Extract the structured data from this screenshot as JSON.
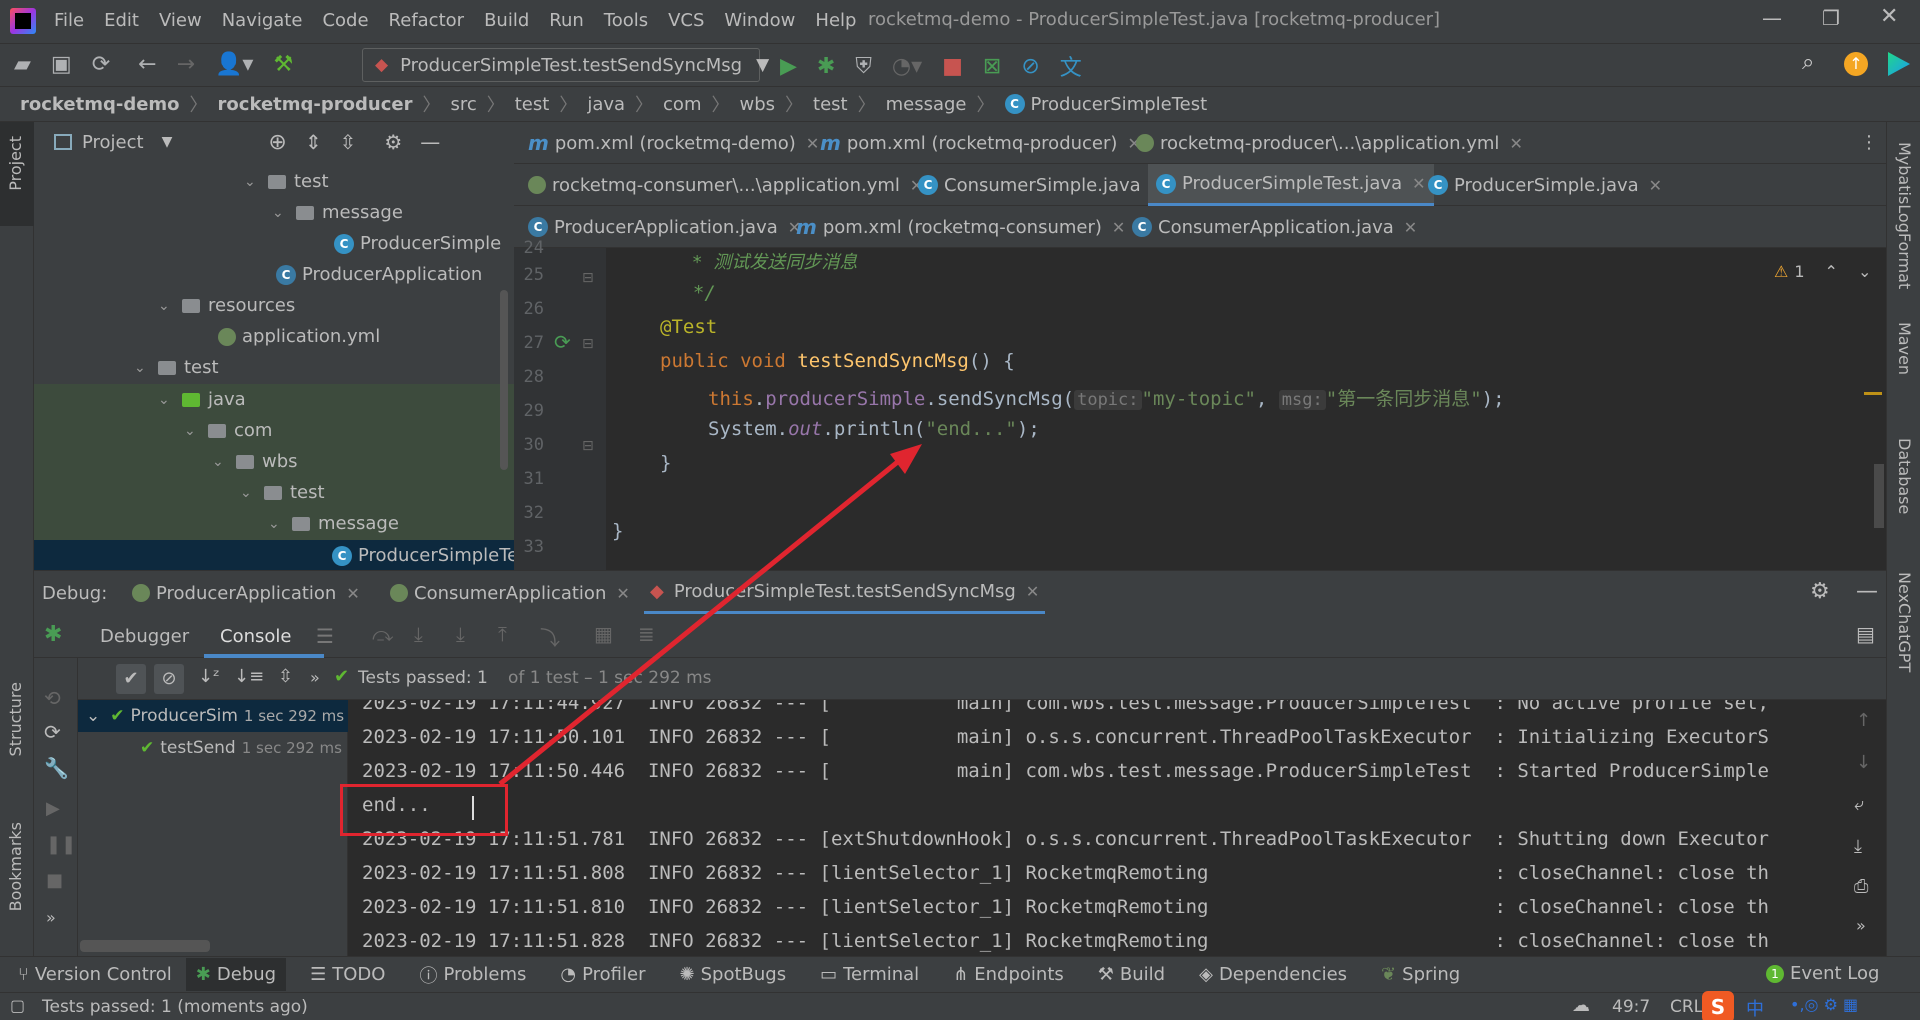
{
  "window": {
    "title": "rocketmq-demo - ProducerSimpleTest.java [rocketmq-producer]",
    "menu": [
      "File",
      "Edit",
      "View",
      "Navigate",
      "Code",
      "Refactor",
      "Build",
      "Run",
      "Tools",
      "VCS",
      "Window",
      "Help"
    ]
  },
  "toolbar": {
    "run_config": "ProducerSimpleTest.testSendSyncMsg"
  },
  "breadcrumb": [
    "rocketmq-demo",
    "rocketmq-producer",
    "src",
    "test",
    "java",
    "com",
    "wbs",
    "test",
    "message",
    "ProducerSimpleTest"
  ],
  "project": {
    "title": "Project",
    "side_label": "Project",
    "tree": [
      {
        "label": "test",
        "indent": 1
      },
      {
        "label": "message",
        "indent": 2
      },
      {
        "label": "ProducerSimple",
        "indent": 3
      },
      {
        "label": "ProducerApplication",
        "indent": 2
      },
      {
        "label": "resources",
        "indent": 1
      },
      {
        "label": "application.yml",
        "indent": 2
      },
      {
        "label": "test",
        "indent": 0
      },
      {
        "label": "java",
        "indent": 1
      },
      {
        "label": "com",
        "indent": 2
      },
      {
        "label": "wbs",
        "indent": 3
      },
      {
        "label": "test",
        "indent": 4
      },
      {
        "label": "message",
        "indent": 5
      },
      {
        "label": "ProducerSimpleTe",
        "indent": 6
      }
    ]
  },
  "editor": {
    "tabs_row1": [
      "pom.xml (rocketmq-demo)",
      "pom.xml (rocketmq-producer)",
      "rocketmq-producer\\...\\application.yml"
    ],
    "tabs_row2": [
      "rocketmq-consumer\\...\\application.yml",
      "ConsumerSimple.java",
      "ProducerSimpleTest.java",
      "ProducerSimple.java"
    ],
    "tabs_row3": [
      "ProducerApplication.java",
      "pom.xml (rocketmq-consumer)",
      "ConsumerApplication.java"
    ],
    "line_numbers": [
      "24",
      "25",
      "26",
      "27",
      "28",
      "29",
      "30",
      "31",
      "32",
      "33"
    ],
    "warning_count": "1",
    "code": {
      "l24": "* 测试发送同步消息",
      "l25": "*/",
      "l26": "@Test",
      "l27_kw": "public void ",
      "l27_fn": "testSendSyncMsg",
      "l27_rest": "() {",
      "l28_this": "this",
      "l28_field": "producerSimple",
      "l28_call": ".sendSyncMsg(",
      "l28_hint1": "topic:",
      "l28_str1": "\"my-topic\"",
      "l28_hint2": "msg:",
      "l28_str2": "\"第一条同步消息\"",
      "l28_end": ");",
      "l29_sys": "System.",
      "l29_out": "out",
      "l29_call": ".println(",
      "l29_str": "\"end...\"",
      "l29_end": ");",
      "l30": "}",
      "l32": "}"
    }
  },
  "debug": {
    "label": "Debug:",
    "tabs": [
      "ProducerApplication",
      "ConsumerApplication",
      "ProducerSimpleTest.testSendSyncMsg"
    ],
    "subtabs": [
      "Debugger",
      "Console"
    ],
    "tests_passed": "Tests passed: 1",
    "tests_detail": "of 1 test – 1 sec 292 ms",
    "test_tree": [
      {
        "label": "ProducerSim",
        "time": "1 sec 292 ms"
      },
      {
        "label": "testSend",
        "time": "1 sec 292 ms"
      }
    ],
    "console_lines": [
      "2023-02-19 17:11:44.927  INFO 26832 --- [           main] com.wbs.test.message.ProducerSimpleTest  : No active profile set,",
      "2023-02-19 17:11:50.101  INFO 26832 --- [           main] o.s.s.concurrent.ThreadPoolTaskExecutor  : Initializing ExecutorS",
      "2023-02-19 17:11:50.446  INFO 26832 --- [           main] com.wbs.test.message.ProducerSimpleTest  : Started ProducerSimple",
      "end...",
      "2023-02-19 17:11:51.781  INFO 26832 --- [extShutdownHook] o.s.s.concurrent.ThreadPoolTaskExecutor  : Shutting down Executor",
      "2023-02-19 17:11:51.808  INFO 26832 --- [lientSelector_1] RocketmqRemoting                         : closeChannel: close th",
      "2023-02-19 17:11:51.810  INFO 26832 --- [lientSelector_1] RocketmqRemoting                         : closeChannel: close th",
      "2023-02-19 17:11:51.828  INFO 26832 --- [lientSelector_1] RocketmqRemoting                         : closeChannel: close th"
    ]
  },
  "right_tools": [
    "MybatisLogFormat",
    "Maven",
    "Database",
    "NexChatGPT"
  ],
  "left_tools": [
    "Structure",
    "Bookmarks"
  ],
  "bottom_tools": [
    "Version Control",
    "Debug",
    "TODO",
    "Problems",
    "Profiler",
    "SpotBugs",
    "Terminal",
    "Endpoints",
    "Build",
    "Dependencies",
    "Spring",
    "Event Log"
  ],
  "status": {
    "message": "Tests passed: 1 (moments ago)",
    "position": "49:7",
    "encoding": "CRL",
    "ime": "中"
  },
  "colors": {
    "annotation_box": "#e0252f",
    "arrow": "#e0252f",
    "accent": "#4a88c7",
    "pass_green": "#5fb832"
  }
}
